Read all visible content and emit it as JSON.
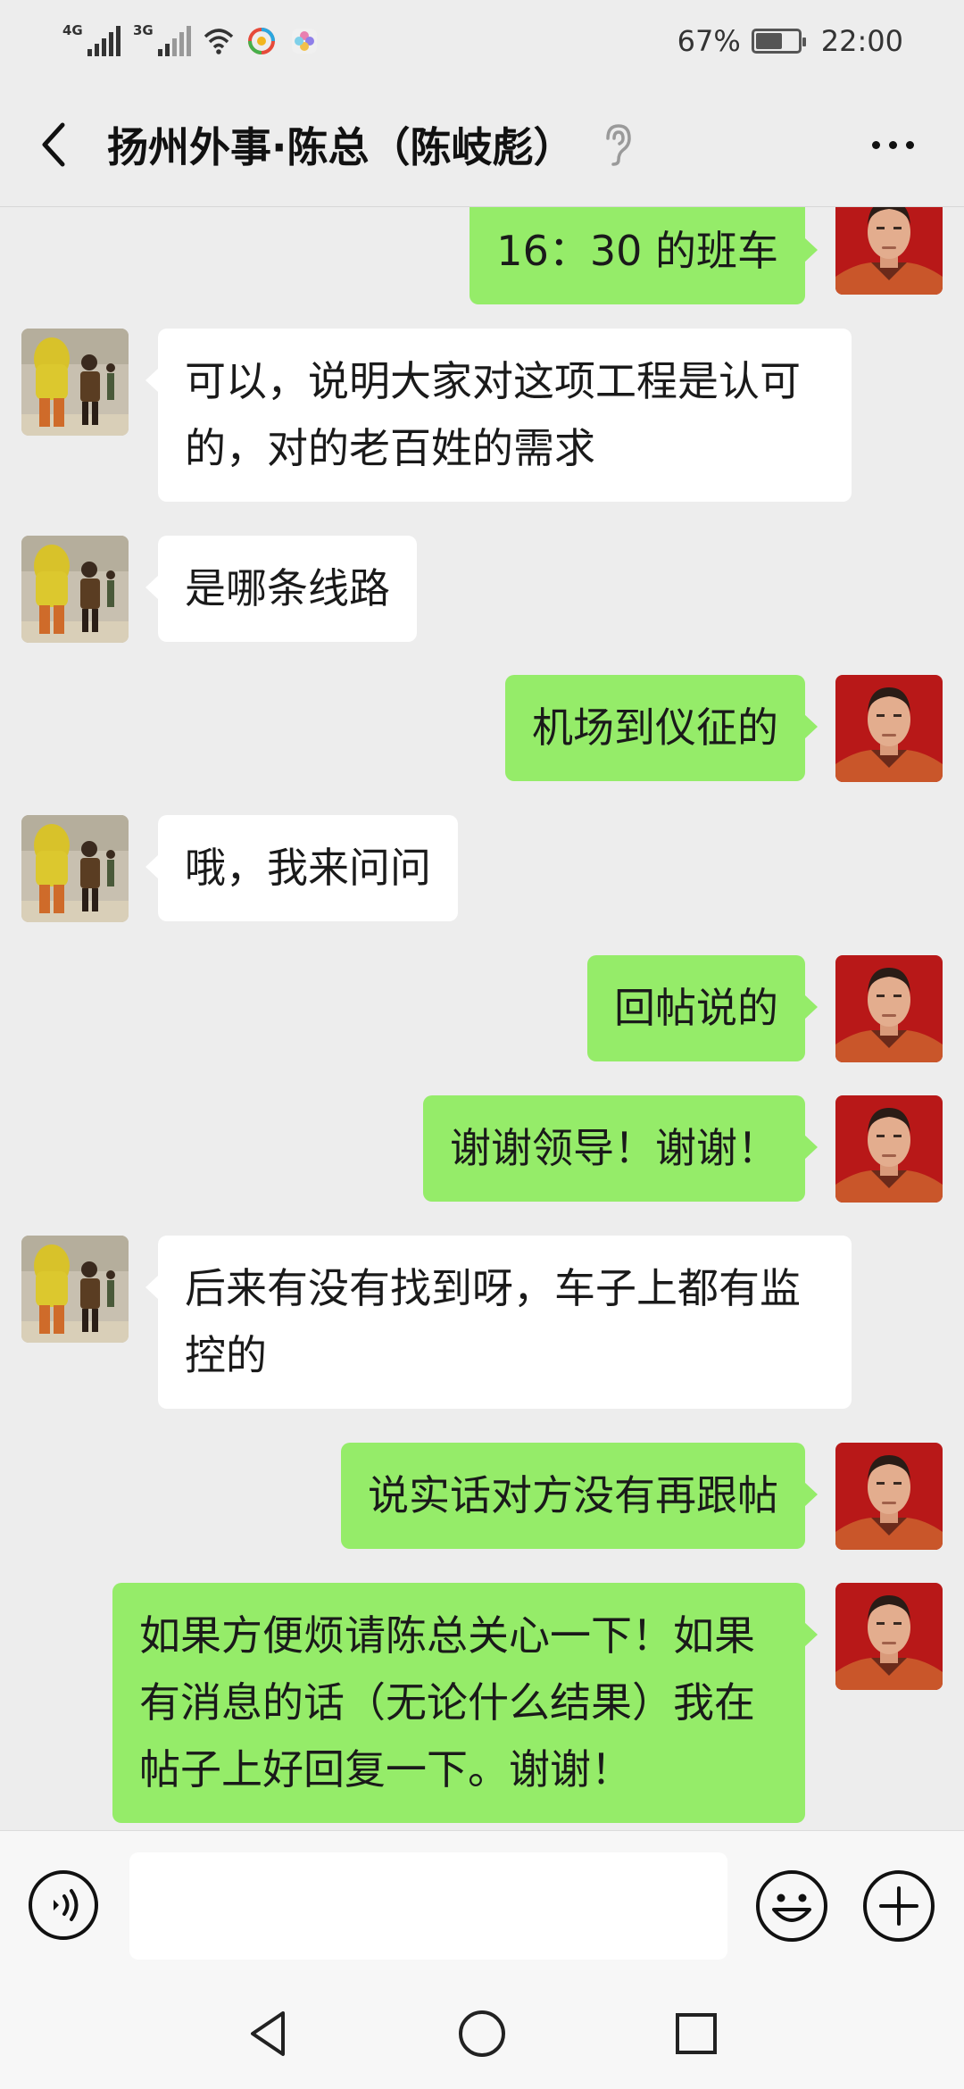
{
  "status_bar": {
    "network_1": "4G",
    "network_2": "3G",
    "battery": "67%",
    "battery_level": 0.67,
    "time": "22:00"
  },
  "header": {
    "title": "扬州外事·陈总（陈岐彪）",
    "back_icon": "chevron-left-icon",
    "earpiece_icon": "ear-icon",
    "more_icon": "more-dots-icon"
  },
  "messages": [
    {
      "side": "out",
      "text": "16：30 的班车"
    },
    {
      "side": "in",
      "text": "可以，说明大家对这项工程是认可的，对的老百姓的需求"
    },
    {
      "side": "in",
      "text": "是哪条线路"
    },
    {
      "side": "out",
      "text": "机场到仪征的"
    },
    {
      "side": "in",
      "text": "哦，我来问问"
    },
    {
      "side": "out",
      "text": "回帖说的"
    },
    {
      "side": "out",
      "text": "谢谢领导！谢谢！"
    },
    {
      "side": "in",
      "text": "后来有没有找到呀，车子上都有监控的"
    },
    {
      "side": "out",
      "text": "说实话对方没有再跟帖"
    },
    {
      "side": "out",
      "text": "如果方便烦请陈总关心一下！如果有消息的话（无论什么结果）我在帖子上好回复一下。谢谢！"
    }
  ],
  "input_bar": {
    "input_value": "",
    "voice_icon": "voice-icon",
    "emoji_icon": "emoji-icon",
    "plus_icon": "plus-icon"
  },
  "nav_bar": {
    "back_icon": "nav-back-icon",
    "home_icon": "nav-home-icon",
    "recents_icon": "nav-recents-icon"
  },
  "colors": {
    "background": "#ededed",
    "outgoing_bubble": "#95ec69",
    "incoming_bubble": "#ffffff"
  }
}
